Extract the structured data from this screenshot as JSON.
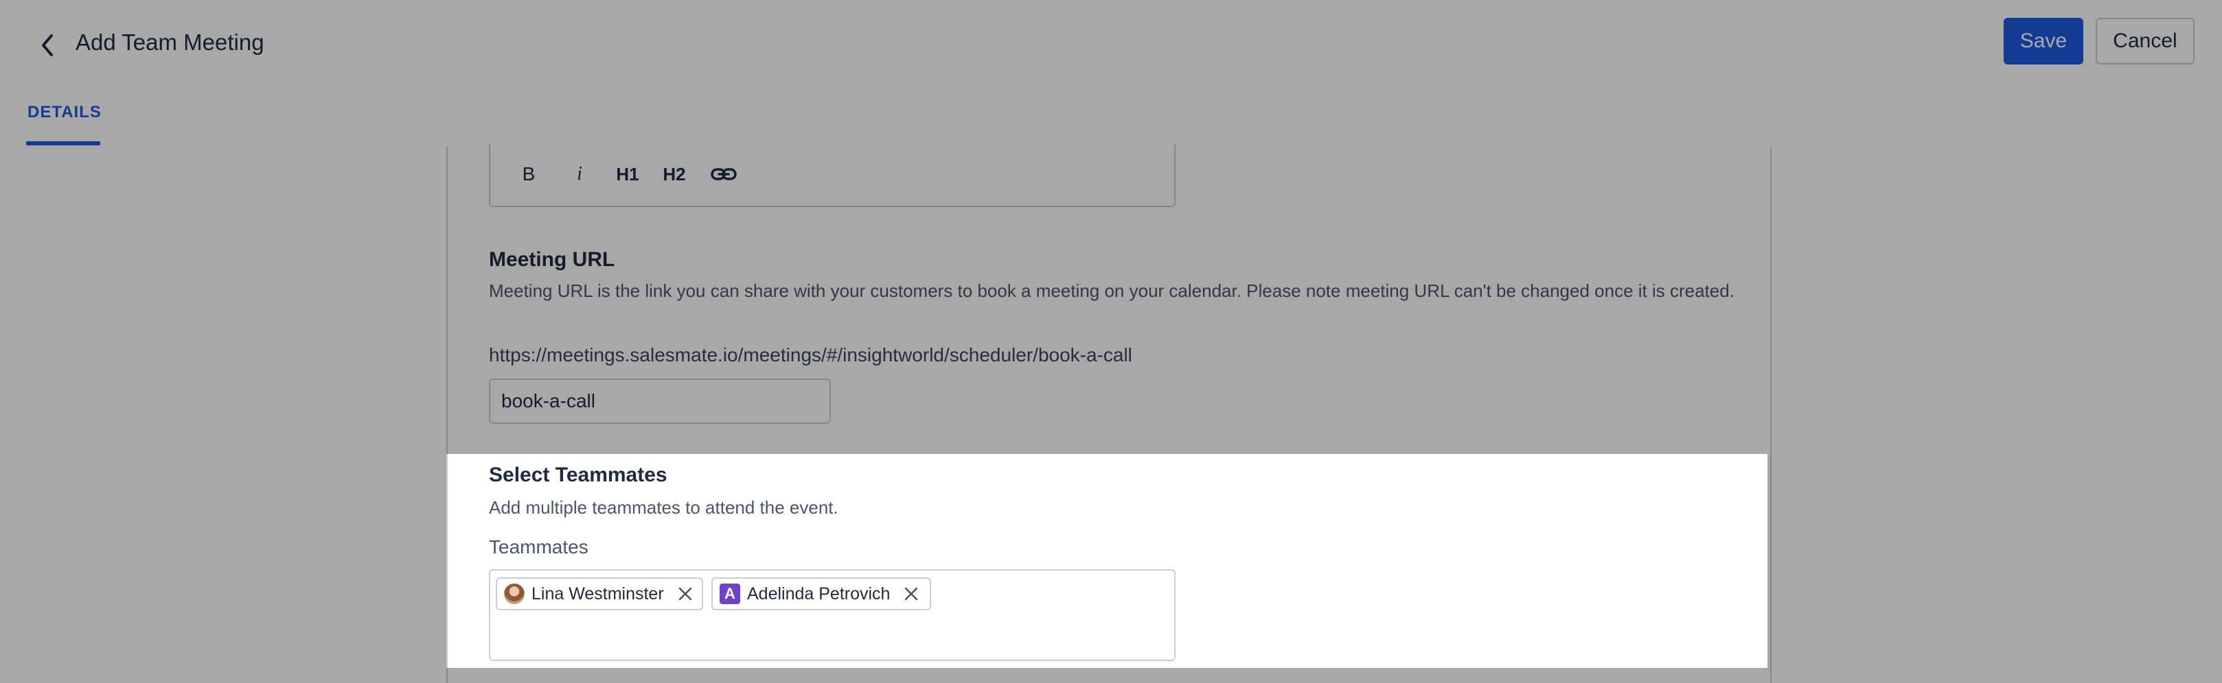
{
  "header": {
    "title": "Add Team Meeting",
    "save_label": "Save",
    "cancel_label": "Cancel"
  },
  "tabs": [
    {
      "label": "DETAILS",
      "active": true
    }
  ],
  "toolbar": {
    "bold": "B",
    "italic": "i",
    "h1": "H1",
    "h2": "H2"
  },
  "meeting_url": {
    "title": "Meeting URL",
    "description": "Meeting URL is the link you can share with your customers to book a meeting on your calendar. Please note meeting URL can't be changed once it is created.",
    "full_url": "https://meetings.salesmate.io/meetings/#/insightworld/scheduler/book-a-call",
    "slug_value": "book-a-call"
  },
  "teammates": {
    "title": "Select Teammates",
    "description": "Add multiple teammates to attend the event.",
    "label": "Teammates",
    "selected": [
      {
        "name": "Lina Westminster",
        "avatar": "photo"
      },
      {
        "name": "Adelinda Petrovich",
        "avatar": "A"
      }
    ]
  },
  "colors": {
    "accent": "#1f5ae0",
    "avatar_letter_bg": "#6f43c8"
  }
}
